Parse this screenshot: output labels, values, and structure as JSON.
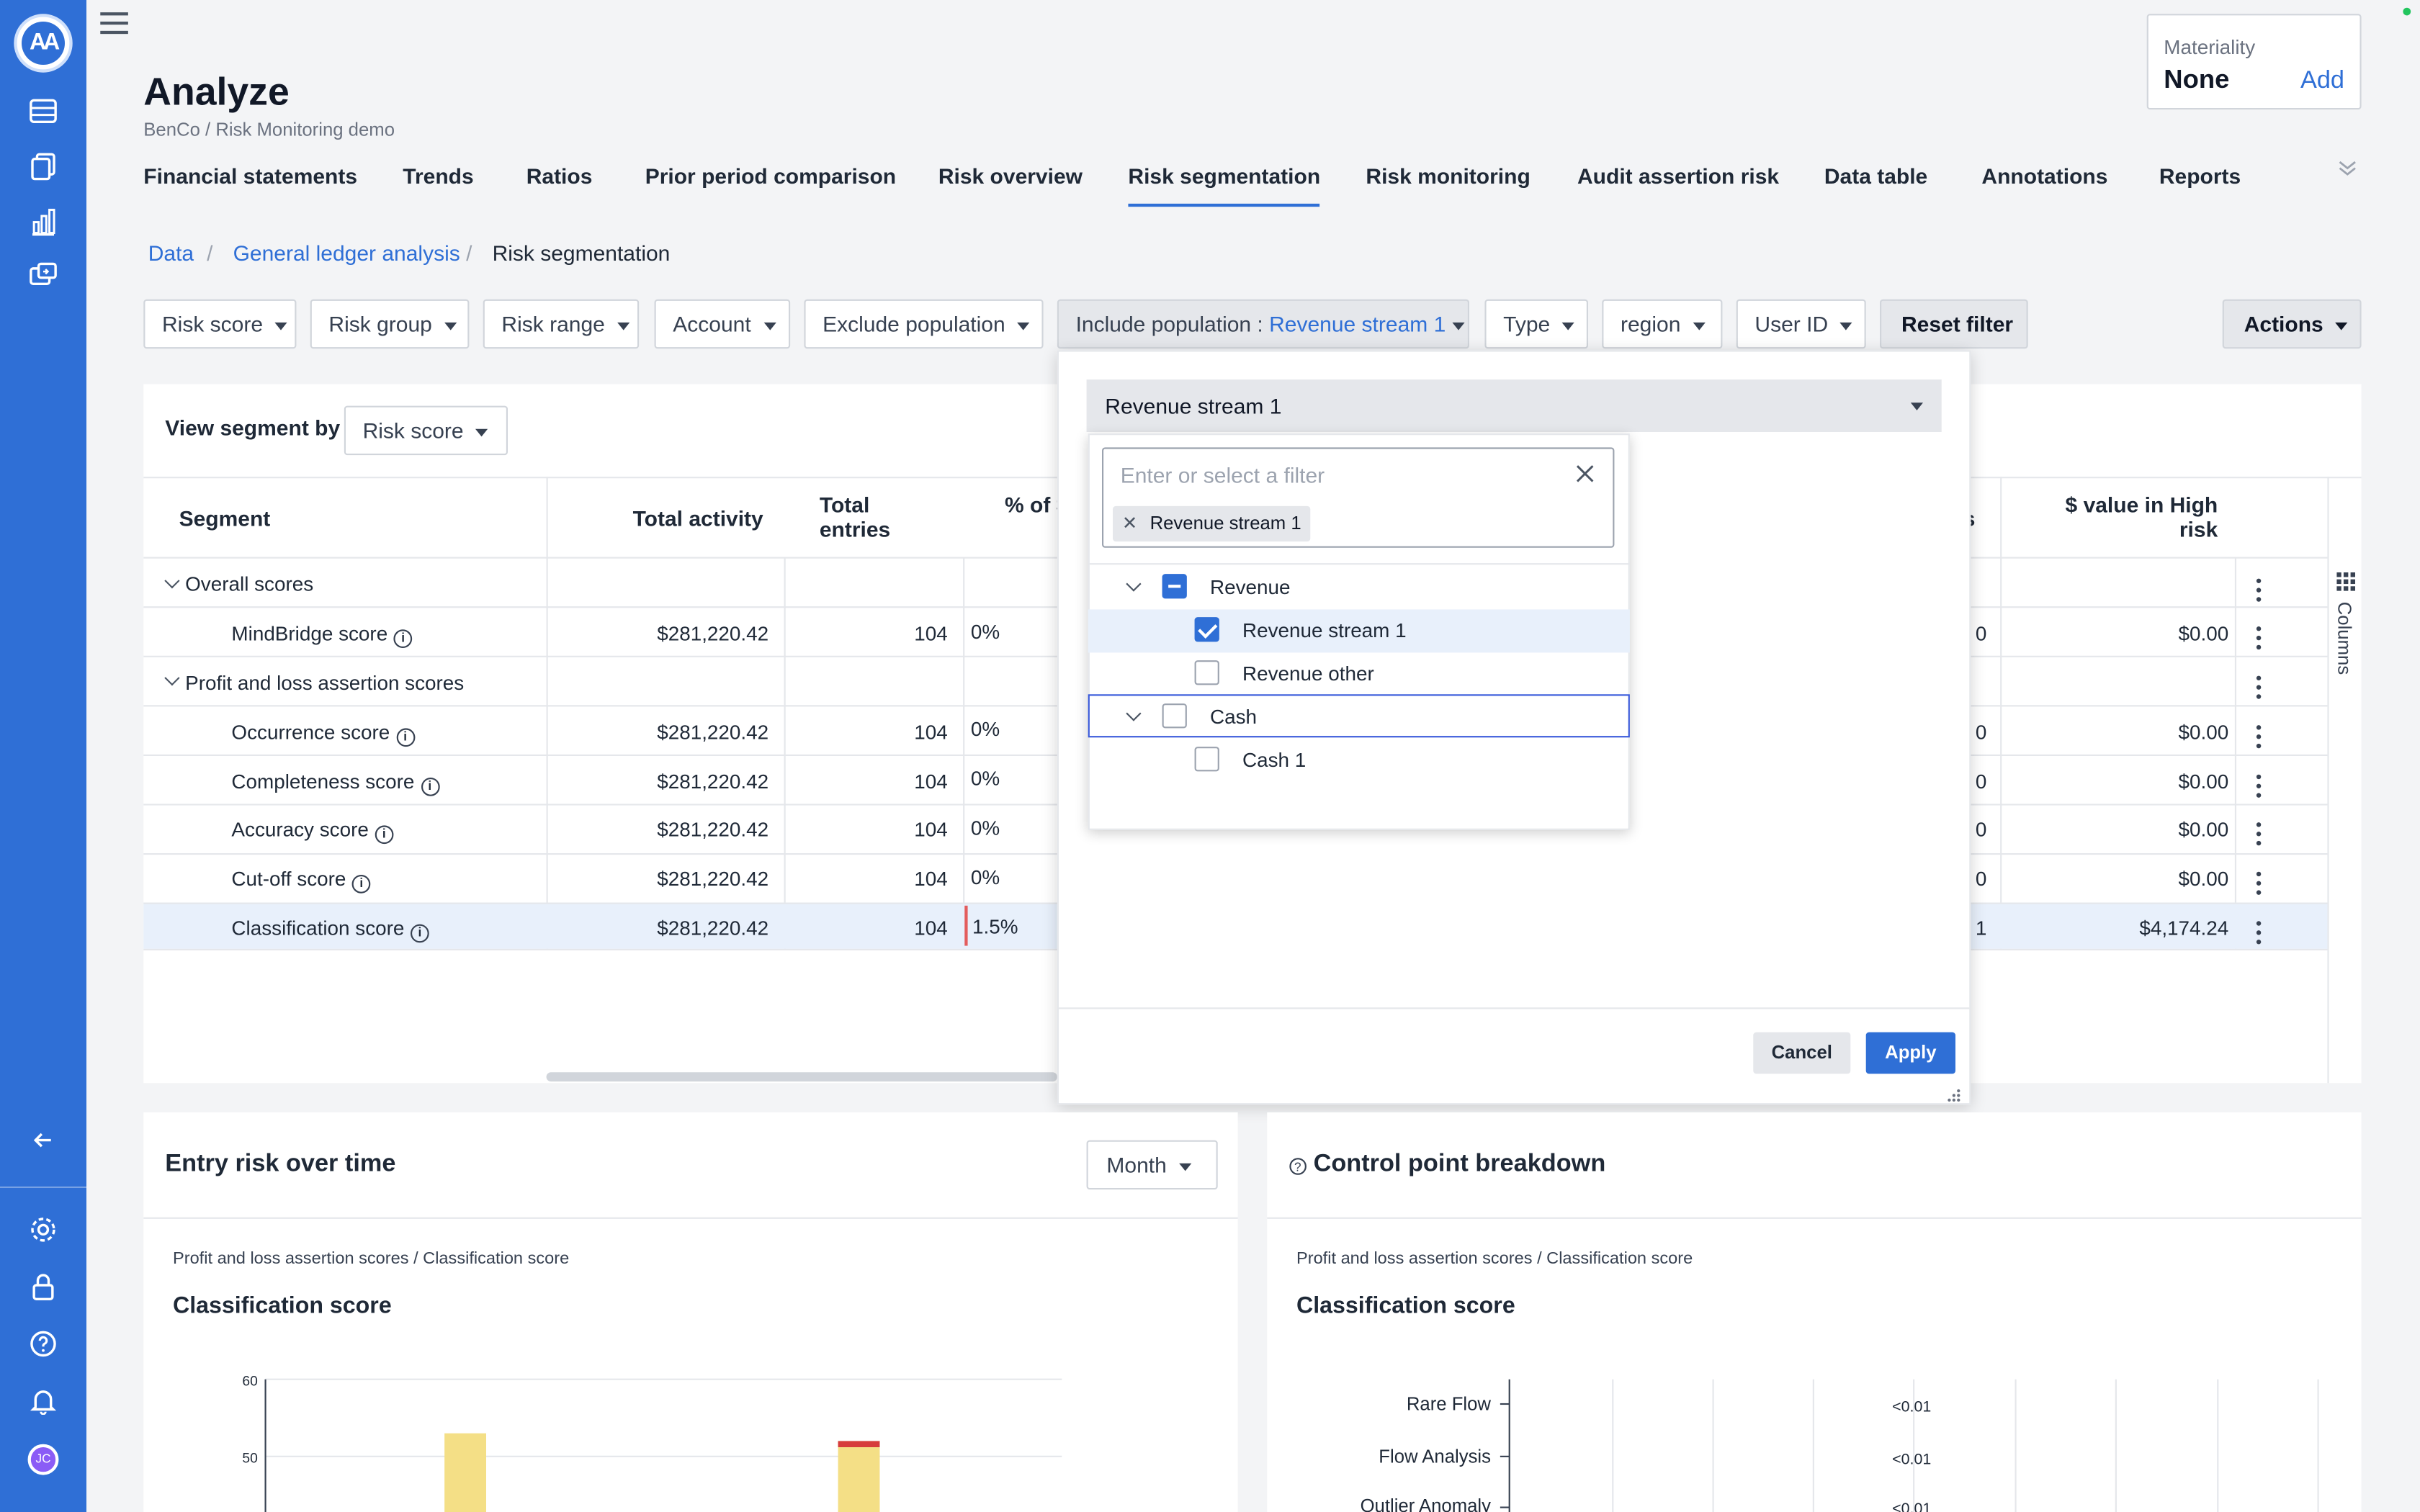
{
  "app": {
    "title": "Analyze",
    "subtitle": "BenCo / Risk Monitoring demo",
    "logo_text": "AA",
    "avatar_initials": "JC"
  },
  "materiality": {
    "label": "Materiality",
    "value": "None",
    "add_label": "Add"
  },
  "sidebar": {
    "icons": [
      "database-icon",
      "documents-icon",
      "bar-chart-icon",
      "transfer-icon"
    ],
    "bottom_icons": [
      "collapse-arrow-icon",
      "gear-icon",
      "lock-icon",
      "help-icon",
      "bell-icon"
    ]
  },
  "tabs": [
    {
      "label": "Financial statements"
    },
    {
      "label": "Trends"
    },
    {
      "label": "Ratios"
    },
    {
      "label": "Prior period comparison"
    },
    {
      "label": "Risk overview"
    },
    {
      "label": "Risk segmentation",
      "active": true
    },
    {
      "label": "Risk monitoring"
    },
    {
      "label": "Audit assertion risk"
    },
    {
      "label": "Data table"
    },
    {
      "label": "Annotations"
    },
    {
      "label": "Reports"
    }
  ],
  "breadcrumb": [
    "Data",
    "General ledger analysis",
    "Risk segmentation"
  ],
  "filters": {
    "risk_score": "Risk score",
    "risk_group": "Risk group",
    "risk_range": "Risk range",
    "account": "Account",
    "exclude_population": "Exclude population",
    "include_population_label": "Include population : ",
    "include_population_value": "Revenue stream 1",
    "type": "Type",
    "region": "region",
    "user_id": "User ID",
    "reset": "Reset filter",
    "actions": "Actions"
  },
  "segment_view": {
    "label": "View segment by",
    "value": "Risk score"
  },
  "table": {
    "headers": {
      "segment": "Segment",
      "total_activity": "Total activity",
      "total_entries_1": "Total",
      "total_entries_2": "entries",
      "pct": "% of $",
      "high_risk_1": "$ value in High",
      "high_risk_2": "risk",
      "hidden_partial": "s"
    },
    "rows": [
      {
        "segment": "Overall scores",
        "group": true
      },
      {
        "segment": "MindBridge score",
        "activity": "$281,220.42",
        "entries": "104",
        "pct": "0%",
        "partial": "0",
        "high": "$0.00"
      },
      {
        "segment": "Profit and loss assertion scores",
        "group": true
      },
      {
        "segment": "Occurrence score",
        "activity": "$281,220.42",
        "entries": "104",
        "pct": "0%",
        "partial": "0",
        "high": "$0.00"
      },
      {
        "segment": "Completeness score",
        "activity": "$281,220.42",
        "entries": "104",
        "pct": "0%",
        "partial": "0",
        "high": "$0.00"
      },
      {
        "segment": "Accuracy score",
        "activity": "$281,220.42",
        "entries": "104",
        "pct": "0%",
        "partial": "0",
        "high": "$0.00"
      },
      {
        "segment": "Cut-off score",
        "activity": "$281,220.42",
        "entries": "104",
        "pct": "0%",
        "partial": "0",
        "high": "$0.00"
      },
      {
        "segment": "Classification score",
        "activity": "$281,220.42",
        "entries": "104",
        "pct": "1.5%",
        "partial": "1",
        "high": "$4,174.24",
        "selected": true
      }
    ],
    "columns_label": "Columns"
  },
  "popup": {
    "select_value": "Revenue stream 1",
    "input_placeholder": "Enter or select a filter",
    "chip": "Revenue stream 1",
    "tree": [
      {
        "label": "Revenue",
        "state": "partial",
        "expanded": true
      },
      {
        "label": "Revenue stream 1",
        "state": "checked",
        "child": true
      },
      {
        "label": "Revenue other",
        "state": "unchecked",
        "child": true
      },
      {
        "label": "Cash",
        "state": "unchecked",
        "expanded": true
      },
      {
        "label": "Cash 1",
        "state": "unchecked",
        "child": true
      }
    ],
    "cancel": "Cancel",
    "apply": "Apply"
  },
  "entry_risk": {
    "title": "Entry risk over time",
    "period": "Month",
    "path": "Profit and loss assertion scores / Classification score",
    "chart_title": "Classification score",
    "chart_data": {
      "type": "bar",
      "y_ticks": [
        60,
        50
      ],
      "ylim": [
        0,
        60
      ],
      "bars": [
        {
          "value": 53,
          "color": "#f4df86"
        },
        {
          "value": 52,
          "color": "#f4df86",
          "top_color": "#d63c3c"
        }
      ]
    }
  },
  "control_point": {
    "title": "Control point breakdown",
    "path": "Profit and loss assertion scores / Classification score",
    "chart_title": "Classification score",
    "chart_data": {
      "type": "bar",
      "categories": [
        "Rare Flow",
        "Flow Analysis",
        "Outlier Anomaly"
      ],
      "value_labels": [
        "<0.01",
        "<0.01",
        "<0.01"
      ]
    }
  }
}
